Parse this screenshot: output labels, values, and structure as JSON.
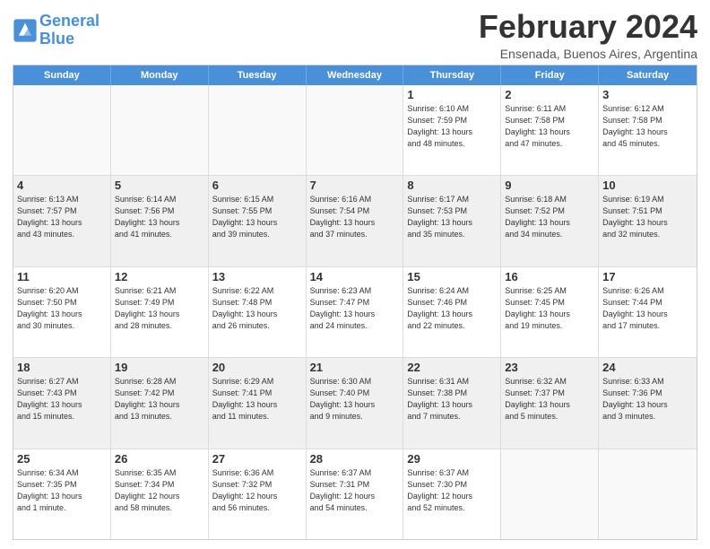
{
  "header": {
    "logo_line1": "General",
    "logo_line2": "Blue",
    "month": "February 2024",
    "location": "Ensenada, Buenos Aires, Argentina"
  },
  "weekdays": [
    "Sunday",
    "Monday",
    "Tuesday",
    "Wednesday",
    "Thursday",
    "Friday",
    "Saturday"
  ],
  "rows": [
    [
      {
        "day": "",
        "info": "",
        "empty": true
      },
      {
        "day": "",
        "info": "",
        "empty": true
      },
      {
        "day": "",
        "info": "",
        "empty": true
      },
      {
        "day": "",
        "info": "",
        "empty": true
      },
      {
        "day": "1",
        "info": "Sunrise: 6:10 AM\nSunset: 7:59 PM\nDaylight: 13 hours\nand 48 minutes.",
        "empty": false
      },
      {
        "day": "2",
        "info": "Sunrise: 6:11 AM\nSunset: 7:58 PM\nDaylight: 13 hours\nand 47 minutes.",
        "empty": false
      },
      {
        "day": "3",
        "info": "Sunrise: 6:12 AM\nSunset: 7:58 PM\nDaylight: 13 hours\nand 45 minutes.",
        "empty": false
      }
    ],
    [
      {
        "day": "4",
        "info": "Sunrise: 6:13 AM\nSunset: 7:57 PM\nDaylight: 13 hours\nand 43 minutes.",
        "empty": false,
        "shaded": true
      },
      {
        "day": "5",
        "info": "Sunrise: 6:14 AM\nSunset: 7:56 PM\nDaylight: 13 hours\nand 41 minutes.",
        "empty": false,
        "shaded": true
      },
      {
        "day": "6",
        "info": "Sunrise: 6:15 AM\nSunset: 7:55 PM\nDaylight: 13 hours\nand 39 minutes.",
        "empty": false,
        "shaded": true
      },
      {
        "day": "7",
        "info": "Sunrise: 6:16 AM\nSunset: 7:54 PM\nDaylight: 13 hours\nand 37 minutes.",
        "empty": false,
        "shaded": true
      },
      {
        "day": "8",
        "info": "Sunrise: 6:17 AM\nSunset: 7:53 PM\nDaylight: 13 hours\nand 35 minutes.",
        "empty": false,
        "shaded": true
      },
      {
        "day": "9",
        "info": "Sunrise: 6:18 AM\nSunset: 7:52 PM\nDaylight: 13 hours\nand 34 minutes.",
        "empty": false,
        "shaded": true
      },
      {
        "day": "10",
        "info": "Sunrise: 6:19 AM\nSunset: 7:51 PM\nDaylight: 13 hours\nand 32 minutes.",
        "empty": false,
        "shaded": true
      }
    ],
    [
      {
        "day": "11",
        "info": "Sunrise: 6:20 AM\nSunset: 7:50 PM\nDaylight: 13 hours\nand 30 minutes.",
        "empty": false
      },
      {
        "day": "12",
        "info": "Sunrise: 6:21 AM\nSunset: 7:49 PM\nDaylight: 13 hours\nand 28 minutes.",
        "empty": false
      },
      {
        "day": "13",
        "info": "Sunrise: 6:22 AM\nSunset: 7:48 PM\nDaylight: 13 hours\nand 26 minutes.",
        "empty": false
      },
      {
        "day": "14",
        "info": "Sunrise: 6:23 AM\nSunset: 7:47 PM\nDaylight: 13 hours\nand 24 minutes.",
        "empty": false
      },
      {
        "day": "15",
        "info": "Sunrise: 6:24 AM\nSunset: 7:46 PM\nDaylight: 13 hours\nand 22 minutes.",
        "empty": false
      },
      {
        "day": "16",
        "info": "Sunrise: 6:25 AM\nSunset: 7:45 PM\nDaylight: 13 hours\nand 19 minutes.",
        "empty": false
      },
      {
        "day": "17",
        "info": "Sunrise: 6:26 AM\nSunset: 7:44 PM\nDaylight: 13 hours\nand 17 minutes.",
        "empty": false
      }
    ],
    [
      {
        "day": "18",
        "info": "Sunrise: 6:27 AM\nSunset: 7:43 PM\nDaylight: 13 hours\nand 15 minutes.",
        "empty": false,
        "shaded": true
      },
      {
        "day": "19",
        "info": "Sunrise: 6:28 AM\nSunset: 7:42 PM\nDaylight: 13 hours\nand 13 minutes.",
        "empty": false,
        "shaded": true
      },
      {
        "day": "20",
        "info": "Sunrise: 6:29 AM\nSunset: 7:41 PM\nDaylight: 13 hours\nand 11 minutes.",
        "empty": false,
        "shaded": true
      },
      {
        "day": "21",
        "info": "Sunrise: 6:30 AM\nSunset: 7:40 PM\nDaylight: 13 hours\nand 9 minutes.",
        "empty": false,
        "shaded": true
      },
      {
        "day": "22",
        "info": "Sunrise: 6:31 AM\nSunset: 7:38 PM\nDaylight: 13 hours\nand 7 minutes.",
        "empty": false,
        "shaded": true
      },
      {
        "day": "23",
        "info": "Sunrise: 6:32 AM\nSunset: 7:37 PM\nDaylight: 13 hours\nand 5 minutes.",
        "empty": false,
        "shaded": true
      },
      {
        "day": "24",
        "info": "Sunrise: 6:33 AM\nSunset: 7:36 PM\nDaylight: 13 hours\nand 3 minutes.",
        "empty": false,
        "shaded": true
      }
    ],
    [
      {
        "day": "25",
        "info": "Sunrise: 6:34 AM\nSunset: 7:35 PM\nDaylight: 13 hours\nand 1 minute.",
        "empty": false
      },
      {
        "day": "26",
        "info": "Sunrise: 6:35 AM\nSunset: 7:34 PM\nDaylight: 12 hours\nand 58 minutes.",
        "empty": false
      },
      {
        "day": "27",
        "info": "Sunrise: 6:36 AM\nSunset: 7:32 PM\nDaylight: 12 hours\nand 56 minutes.",
        "empty": false
      },
      {
        "day": "28",
        "info": "Sunrise: 6:37 AM\nSunset: 7:31 PM\nDaylight: 12 hours\nand 54 minutes.",
        "empty": false
      },
      {
        "day": "29",
        "info": "Sunrise: 6:37 AM\nSunset: 7:30 PM\nDaylight: 12 hours\nand 52 minutes.",
        "empty": false
      },
      {
        "day": "",
        "info": "",
        "empty": true
      },
      {
        "day": "",
        "info": "",
        "empty": true
      }
    ]
  ]
}
